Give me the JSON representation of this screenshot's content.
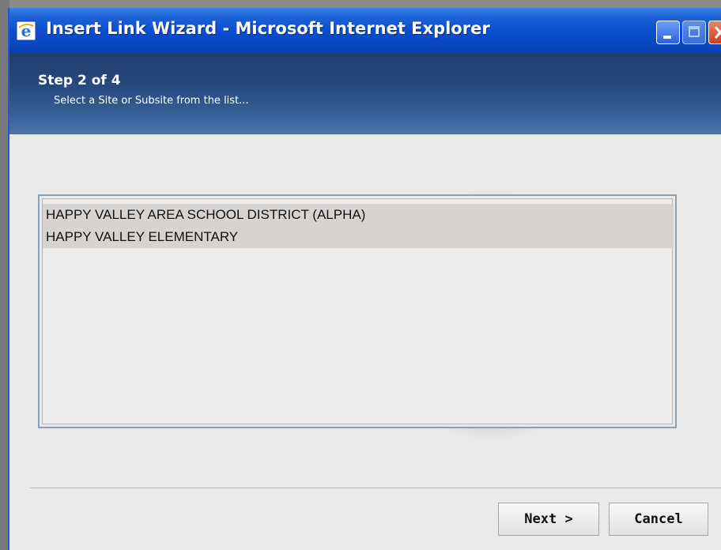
{
  "window": {
    "title": "Insert Link Wizard - Microsoft Internet Explorer"
  },
  "header": {
    "step": "Step 2 of 4",
    "instruction": "Select a Site or Subsite from the list..."
  },
  "site_list": {
    "items": [
      {
        "label": "HAPPY VALLEY AREA SCHOOL DISTRICT (ALPHA)"
      },
      {
        "label": "HAPPY VALLEY ELEMENTARY"
      }
    ]
  },
  "buttons": {
    "next_label": "Next >",
    "cancel_label": "Cancel"
  },
  "icons": {
    "app_icon": "internet-explorer-icon",
    "minimize": "minimize-icon",
    "maximize": "maximize-icon",
    "close": "close-icon"
  },
  "colors": {
    "titlebar": "#0a4fcf",
    "banner": "#264a7e",
    "list_item_bg": "#d6d3d1",
    "body_bg": "#e9e9e9"
  }
}
